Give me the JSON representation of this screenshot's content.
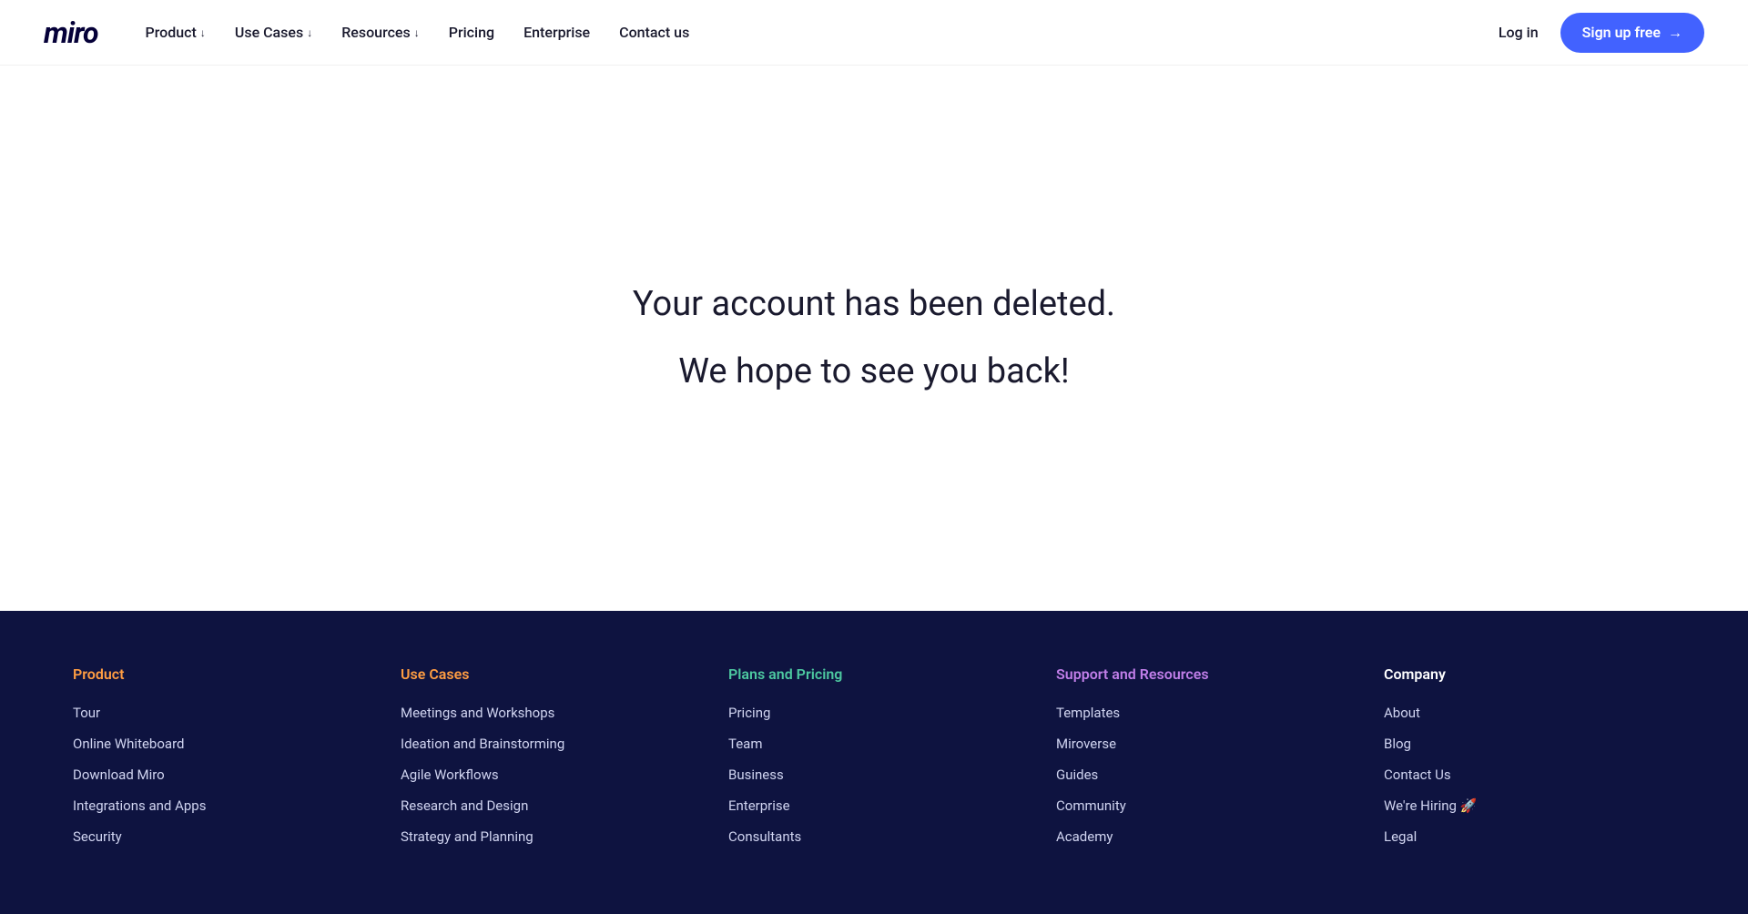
{
  "header": {
    "logo": "miro",
    "nav": [
      {
        "label": "Product",
        "hasArrow": true,
        "id": "product"
      },
      {
        "label": "Use Cases",
        "hasArrow": true,
        "id": "use-cases"
      },
      {
        "label": "Resources",
        "hasArrow": true,
        "id": "resources"
      },
      {
        "label": "Pricing",
        "hasArrow": false,
        "id": "pricing"
      },
      {
        "label": "Enterprise",
        "hasArrow": false,
        "id": "enterprise"
      },
      {
        "label": "Contact us",
        "hasArrow": false,
        "id": "contact-us"
      }
    ],
    "login_label": "Log in",
    "signup_label": "Sign up free",
    "signup_arrow": "→"
  },
  "main": {
    "line1": "Your account has been deleted.",
    "line2": "We hope to see you back!"
  },
  "footer": {
    "columns": [
      {
        "id": "product",
        "title": "Product",
        "color": "product-color",
        "links": [
          {
            "label": "Tour",
            "id": "tour"
          },
          {
            "label": "Online Whiteboard",
            "id": "online-whiteboard"
          },
          {
            "label": "Download Miro",
            "id": "download-miro"
          },
          {
            "label": "Integrations and Apps",
            "id": "integrations-and-apps"
          },
          {
            "label": "Security",
            "id": "security"
          }
        ]
      },
      {
        "id": "use-cases",
        "title": "Use Cases",
        "color": "use-cases-color",
        "links": [
          {
            "label": "Meetings and Workshops",
            "id": "meetings-and-workshops"
          },
          {
            "label": "Ideation and Brainstorming",
            "id": "ideation-and-brainstorming"
          },
          {
            "label": "Agile Workflows",
            "id": "agile-workflows"
          },
          {
            "label": "Research and Design",
            "id": "research-and-design"
          },
          {
            "label": "Strategy and Planning",
            "id": "strategy-and-planning"
          }
        ]
      },
      {
        "id": "plans-and-pricing",
        "title": "Plans and Pricing",
        "color": "plans-color",
        "links": [
          {
            "label": "Pricing",
            "id": "pricing"
          },
          {
            "label": "Team",
            "id": "team"
          },
          {
            "label": "Business",
            "id": "business"
          },
          {
            "label": "Enterprise",
            "id": "enterprise"
          },
          {
            "label": "Consultants",
            "id": "consultants"
          }
        ]
      },
      {
        "id": "support-and-resources",
        "title": "Support and Resources",
        "color": "support-color",
        "links": [
          {
            "label": "Templates",
            "id": "templates"
          },
          {
            "label": "Miroverse",
            "id": "miroverse"
          },
          {
            "label": "Guides",
            "id": "guides"
          },
          {
            "label": "Community",
            "id": "community"
          },
          {
            "label": "Academy",
            "id": "academy"
          }
        ]
      },
      {
        "id": "company",
        "title": "Company",
        "color": "company-color",
        "links": [
          {
            "label": "About",
            "id": "about"
          },
          {
            "label": "Blog",
            "id": "blog"
          },
          {
            "label": "Contact Us",
            "id": "contact-us"
          },
          {
            "label": "We're Hiring 🚀",
            "id": "hiring"
          },
          {
            "label": "Legal",
            "id": "legal"
          }
        ]
      }
    ]
  }
}
